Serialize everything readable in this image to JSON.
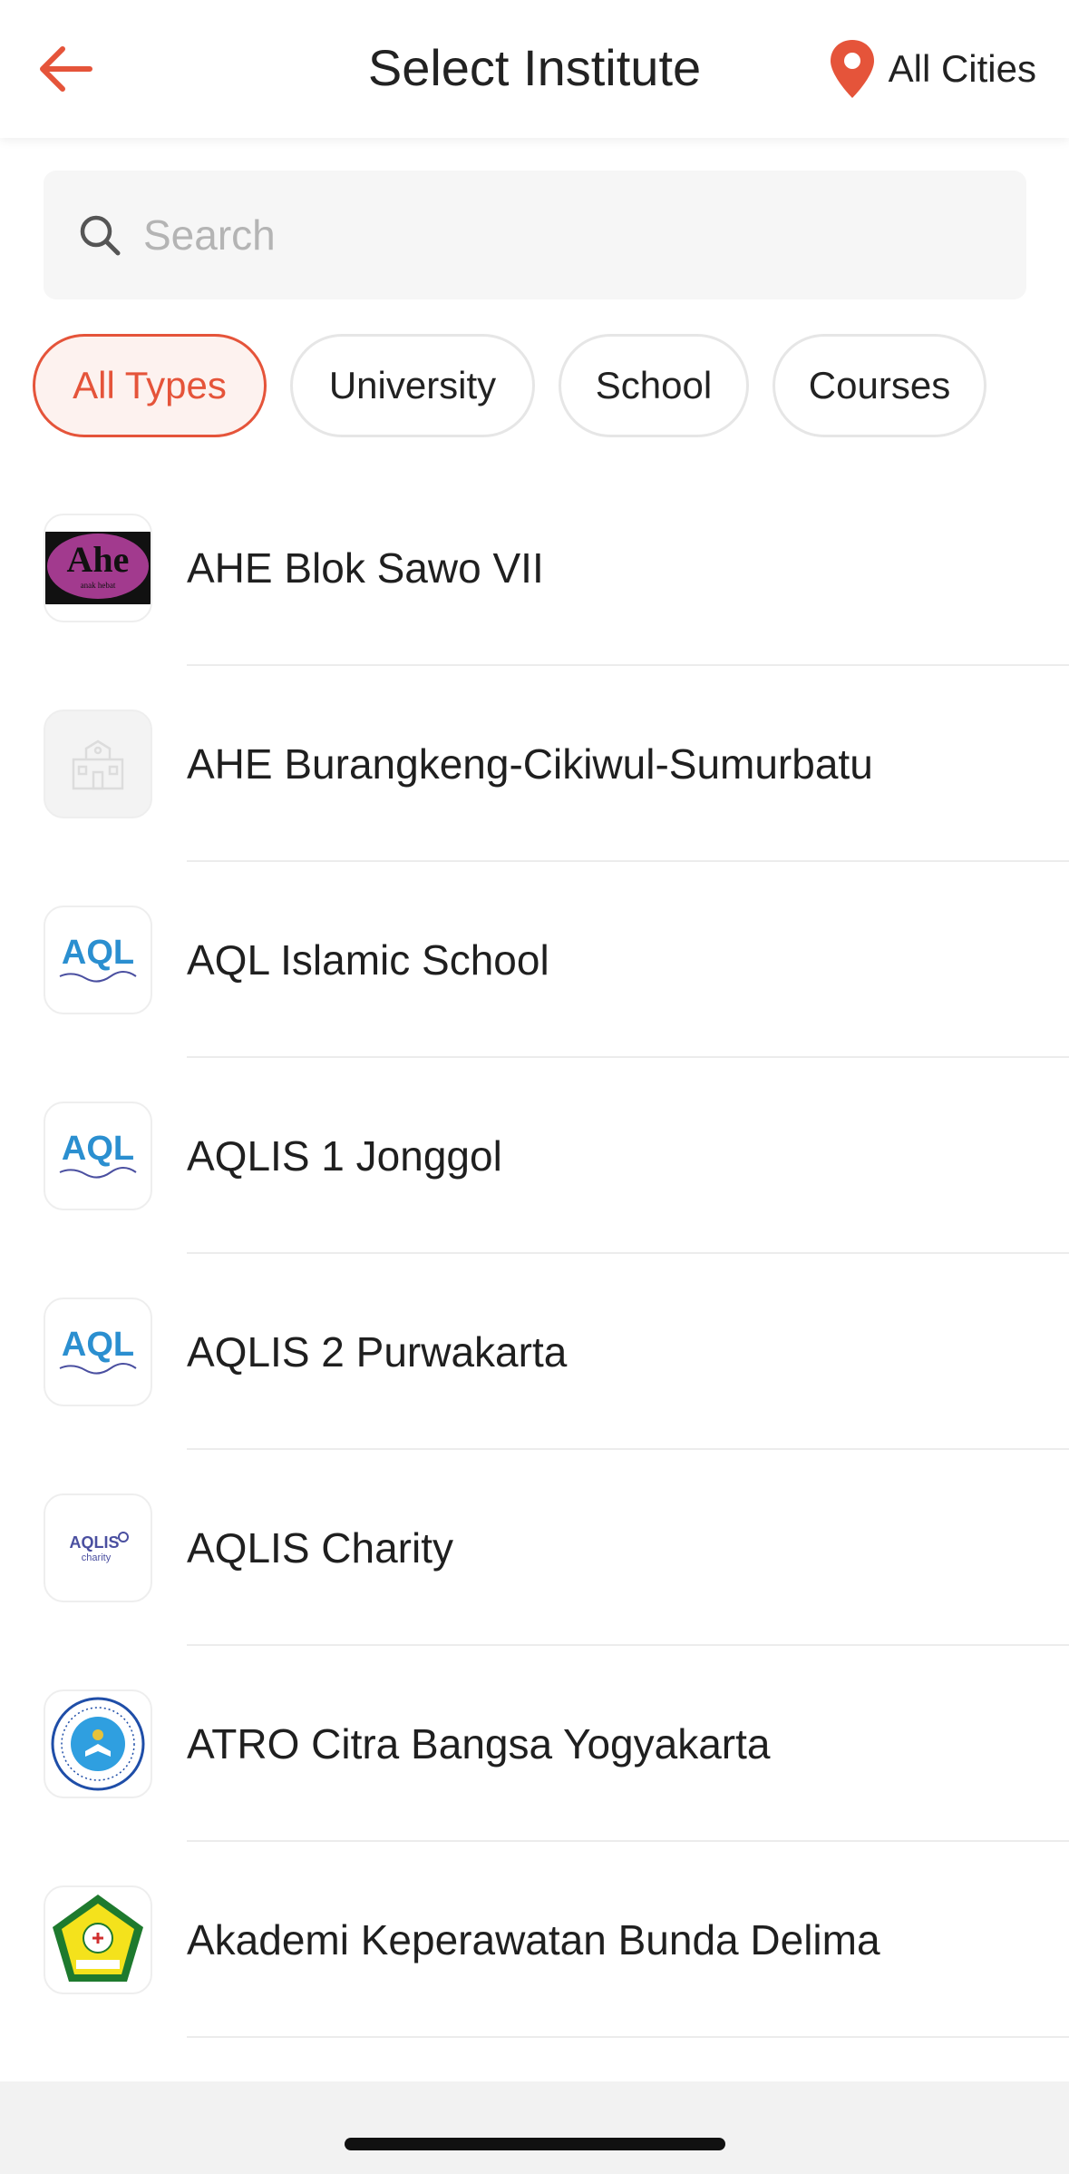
{
  "header": {
    "title": "Select Institute",
    "city_label": "All Cities",
    "back_icon": "arrow-left-icon",
    "location_icon": "map-pin-icon",
    "accent_color": "#e5543a"
  },
  "search": {
    "placeholder": "Search",
    "value": "",
    "icon": "search-icon"
  },
  "filters": [
    {
      "label": "All Types",
      "active": true
    },
    {
      "label": "University",
      "active": false
    },
    {
      "label": "School",
      "active": false
    },
    {
      "label": "Courses",
      "active": false
    }
  ],
  "institutes": [
    {
      "name": "AHE Blok Sawo VII",
      "logo_text": "Ahe",
      "logo_subtext": "anak hebat"
    },
    {
      "name": "AHE Burangkeng-Cikiwul-Sumurbatu",
      "logo_icon": "school-building-icon"
    },
    {
      "name": "AQL Islamic School",
      "logo_text": "AQL"
    },
    {
      "name": "AQLIS 1 Jonggol",
      "logo_text": "AQL"
    },
    {
      "name": "AQLIS 2 Purwakarta",
      "logo_text": "AQL"
    },
    {
      "name": "AQLIS Charity",
      "logo_text": "AQLIS",
      "logo_subtext": "charity"
    },
    {
      "name": "ATRO Citra Bangsa Yogyakarta",
      "logo_icon": "seal-icon"
    },
    {
      "name": "Akademi Keperawatan Bunda Delima",
      "logo_icon": "pentagon-shield-icon"
    }
  ]
}
